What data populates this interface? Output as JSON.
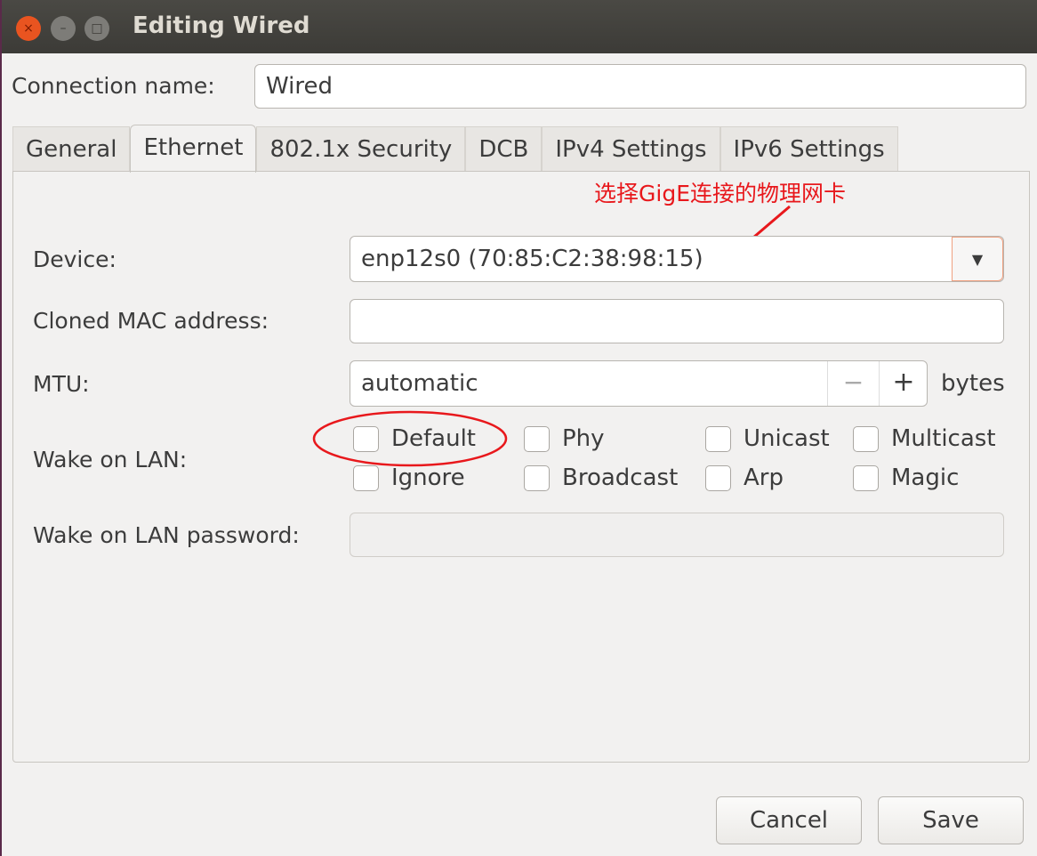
{
  "window": {
    "title": "Editing Wired",
    "close_glyph": "×",
    "min_glyph": "–",
    "max_glyph": "□"
  },
  "connection": {
    "label": "Connection name:",
    "value": "Wired"
  },
  "tabs": [
    {
      "label": "General"
    },
    {
      "label": "Ethernet",
      "active": true
    },
    {
      "label": "802.1x Security"
    },
    {
      "label": "DCB"
    },
    {
      "label": "IPv4 Settings"
    },
    {
      "label": "IPv6 Settings"
    }
  ],
  "annotation": {
    "text": "选择GigE连接的物理网卡",
    "color": "#e8181c"
  },
  "device": {
    "label": "Device:",
    "value": "enp12s0 (70:85:C2:38:98:15)"
  },
  "cloned_mac": {
    "label": "Cloned MAC address:",
    "value": ""
  },
  "mtu": {
    "label": "MTU:",
    "value": "automatic",
    "minus": "−",
    "plus": "+",
    "unit": "bytes"
  },
  "wol": {
    "label": "Wake on LAN:",
    "options": [
      {
        "label": "Default",
        "checked": false
      },
      {
        "label": "Phy",
        "checked": false
      },
      {
        "label": "Unicast",
        "checked": false
      },
      {
        "label": "Multicast",
        "checked": false
      },
      {
        "label": "Ignore",
        "checked": false
      },
      {
        "label": "Broadcast",
        "checked": false
      },
      {
        "label": "Arp",
        "checked": false
      },
      {
        "label": "Magic",
        "checked": false
      }
    ]
  },
  "wol_password": {
    "label": "Wake on LAN password:",
    "value": ""
  },
  "buttons": {
    "cancel": "Cancel",
    "save": "Save"
  }
}
